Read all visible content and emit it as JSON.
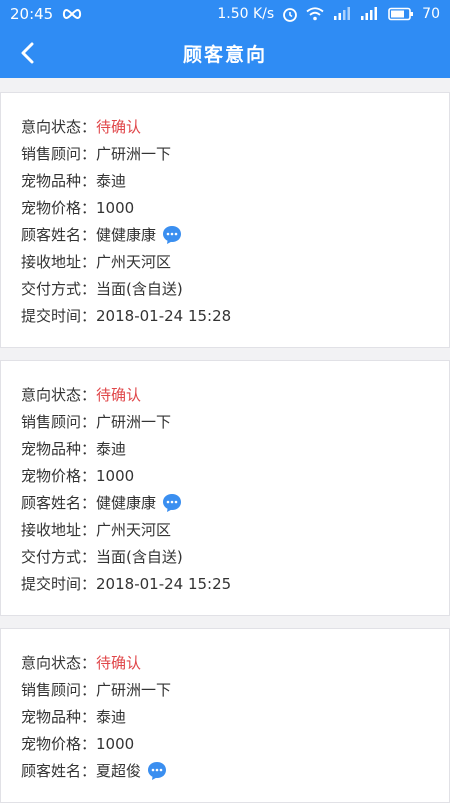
{
  "status_bar": {
    "time": "20:45",
    "speed": "1.50 K/s",
    "battery": "70"
  },
  "header": {
    "title": "顾客意向"
  },
  "labels": {
    "status": "意向状态：",
    "advisor": "销售顾问：",
    "breed": "宠物品种：",
    "price": "宠物价格：",
    "customer": "顾客姓名：",
    "address": "接收地址：",
    "delivery": "交付方式：",
    "time": "提交时间："
  },
  "orders": [
    {
      "status": "待确认",
      "advisor": "广研洲一下",
      "breed": "泰迪",
      "price": "1000",
      "customer": "健健康康",
      "address": "广州天河区",
      "delivery": "当面(含自送)",
      "time": "2018-01-24 15:28"
    },
    {
      "status": "待确认",
      "advisor": "广研洲一下",
      "breed": "泰迪",
      "price": "1000",
      "customer": "健健康康",
      "address": "广州天河区",
      "delivery": "当面(含自送)",
      "time": "2018-01-24 15:25"
    },
    {
      "status": "待确认",
      "advisor": "广研洲一下",
      "breed": "泰迪",
      "price": "1000",
      "customer": "夏超俊"
    }
  ],
  "colors": {
    "primary": "#2f8cf4",
    "pending": "#e0474a",
    "chat": "#3b8ff0"
  }
}
